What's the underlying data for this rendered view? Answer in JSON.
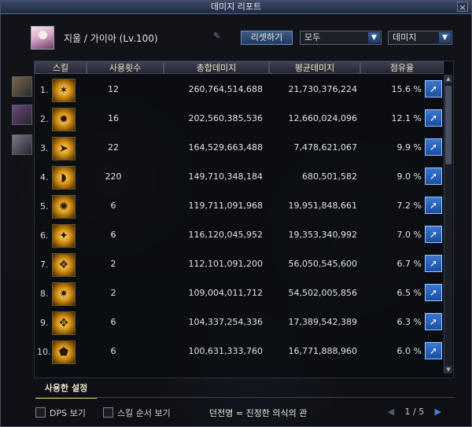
{
  "window": {
    "title": "데미지 리포트",
    "close_label": "×"
  },
  "character": {
    "name": "지울 / 가이아 (Lv.100)"
  },
  "controls": {
    "reset_label": "리셋하기",
    "filter_value": "모두",
    "sort_value": "데미지"
  },
  "table": {
    "headers": {
      "skill": "스킬",
      "uses": "사용횟수",
      "total": "총합데미지",
      "avg": "평균데미지",
      "share": "점유율"
    },
    "rows": [
      {
        "rank": "1.",
        "icon": "claw-skill-icon",
        "uses": "12",
        "total": "260,764,514,688",
        "avg": "21,730,376,224",
        "share": "15.6 %"
      },
      {
        "rank": "2.",
        "icon": "burst-skill-icon",
        "uses": "16",
        "total": "202,560,385,536",
        "avg": "12,660,024,096",
        "share": "12.1 %"
      },
      {
        "rank": "3.",
        "icon": "lance-skill-icon",
        "uses": "22",
        "total": "164,529,663,488",
        "avg": "7,478,621,067",
        "share": "9.9 %"
      },
      {
        "rank": "4.",
        "icon": "shield-skill-icon",
        "uses": "220",
        "total": "149,710,348,184",
        "avg": "680,501,582",
        "share": "9.0 %"
      },
      {
        "rank": "5.",
        "icon": "light-skill-icon",
        "uses": "6",
        "total": "119,711,091,968",
        "avg": "19,951,848,661",
        "share": "7.2 %"
      },
      {
        "rank": "6.",
        "icon": "flame-skill-icon",
        "uses": "6",
        "total": "116,120,045,952",
        "avg": "19,353,340,992",
        "share": "7.0 %"
      },
      {
        "rank": "7.",
        "icon": "wing-skill-icon",
        "uses": "2",
        "total": "112,101,091,200",
        "avg": "56,050,545,600",
        "share": "6.7 %"
      },
      {
        "rank": "8.",
        "icon": "phoenix-skill-icon",
        "uses": "2",
        "total": "109,004,011,712",
        "avg": "54,502,005,856",
        "share": "6.5 %"
      },
      {
        "rank": "9.",
        "icon": "rune-skill-icon",
        "uses": "6",
        "total": "104,337,254,336",
        "avg": "17,389,542,389",
        "share": "6.3 %"
      },
      {
        "rank": "10.",
        "icon": "guard-skill-icon",
        "uses": "6",
        "total": "100,631,333,760",
        "avg": "16,771,888,960",
        "share": "6.0 %"
      }
    ]
  },
  "footer": {
    "settings_tab": "사용한 설정",
    "dps_label": "DPS 보기",
    "skill_order_label": "스킬 순서 보기",
    "dungeon_label": "던전명 = 진정한 의식의 관",
    "page": "1 / 5"
  }
}
